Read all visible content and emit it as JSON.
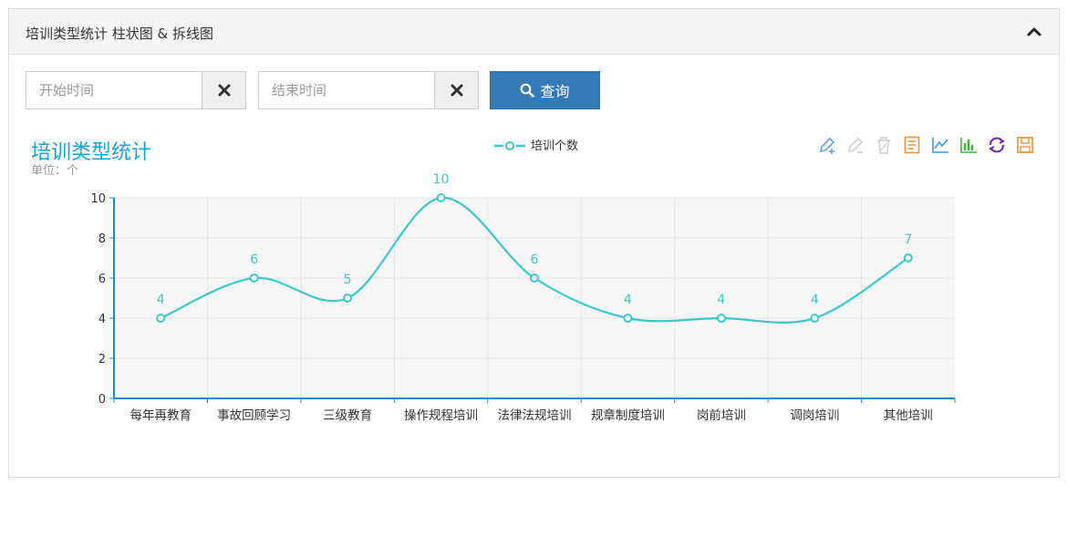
{
  "panel": {
    "title": "培训类型统计 柱状图 & 拆线图"
  },
  "search": {
    "start_placeholder": "开始时间",
    "end_placeholder": "结束时间",
    "query_label": "查询"
  },
  "chart_data": {
    "type": "line",
    "title": "培训类型统计",
    "subtitle": "单位：个",
    "categories": [
      "每年再教育",
      "事故回顾学习",
      "三级教育",
      "操作规程培训",
      "法律法规培训",
      "规章制度培训",
      "岗前培训",
      "调岗培训",
      "其他培训"
    ],
    "series": [
      {
        "name": "培训个数",
        "values": [
          4,
          6,
          5,
          10,
          6,
          4,
          4,
          4,
          7
        ]
      }
    ],
    "ylim": [
      0,
      10
    ],
    "yticks": [
      0,
      2,
      4,
      6,
      8,
      10
    ],
    "legend_position": "top-center",
    "grid": true,
    "smooth": true,
    "data_labels": true,
    "colors": {
      "series": "#3cc7c9",
      "title": "#1aa3d6",
      "axis": "#1a8ccd",
      "plot_bg": "#f7f7f7"
    }
  },
  "toolbox": {
    "icons": [
      "mark-icon",
      "mark-undo-icon",
      "mark-clear-icon",
      "data-view-icon",
      "line-type-icon",
      "bar-type-icon",
      "restore-icon",
      "save-image-icon"
    ],
    "colors": [
      "#5aa2e6",
      "#cfcfcf",
      "#cfcfcf",
      "#e8913e",
      "#3c97e3",
      "#3db33d",
      "#6e2aa5",
      "#e8913e"
    ]
  }
}
